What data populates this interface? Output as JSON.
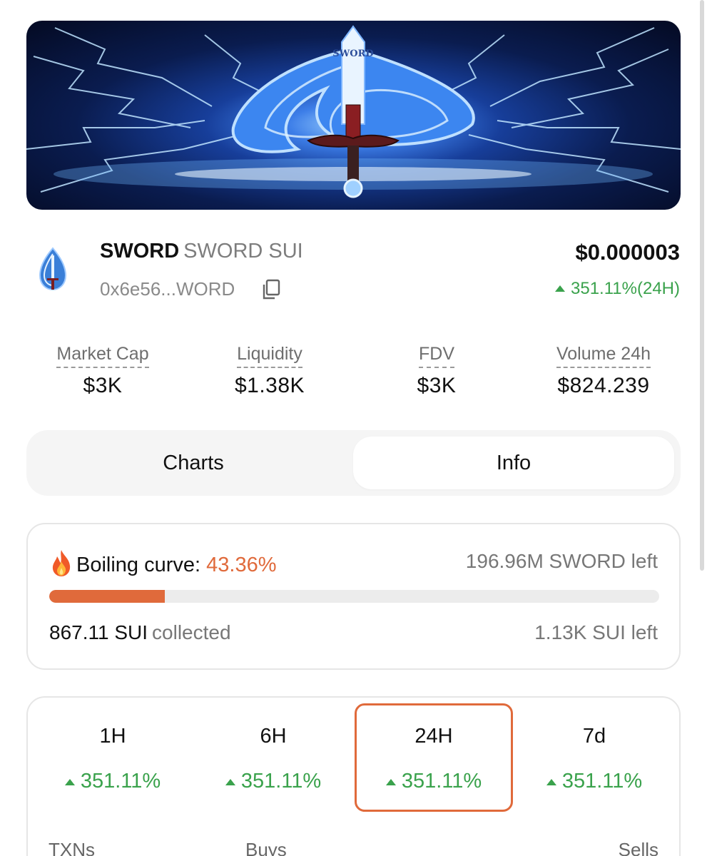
{
  "banner": {
    "sword_text": "SWORD"
  },
  "token": {
    "symbol": "SWORD",
    "name": "SWORD SUI",
    "address": "0x6e56...WORD",
    "price": "$0.000003",
    "change_24h": "351.11%(24H)"
  },
  "stats": [
    {
      "label": "Market Cap",
      "value": "$3K"
    },
    {
      "label": "Liquidity",
      "value": "$1.38K"
    },
    {
      "label": "FDV",
      "value": "$3K"
    },
    {
      "label": "Volume 24h",
      "value": "$824.239"
    }
  ],
  "tabs": {
    "charts": "Charts",
    "info": "Info",
    "selected": "Info"
  },
  "curve": {
    "label": "Boiling curve:",
    "percent": "43.36%",
    "progress": 0.19,
    "tokens_left": "196.96M SWORD left",
    "collected_amount": "867.11 SUI",
    "collected_suffix": "collected",
    "sui_left": "1.13K SUI left"
  },
  "periods": [
    {
      "label": "1H",
      "change": "351.11%"
    },
    {
      "label": "6H",
      "change": "351.11%"
    },
    {
      "label": "24H",
      "change": "351.11%",
      "selected": true
    },
    {
      "label": "7d",
      "change": "351.11%"
    }
  ],
  "footer": {
    "txns": "TXNs",
    "buys": "Buys",
    "sells": "Sells"
  },
  "colors": {
    "accent": "#e06a3b",
    "positive": "#3aa24c"
  }
}
